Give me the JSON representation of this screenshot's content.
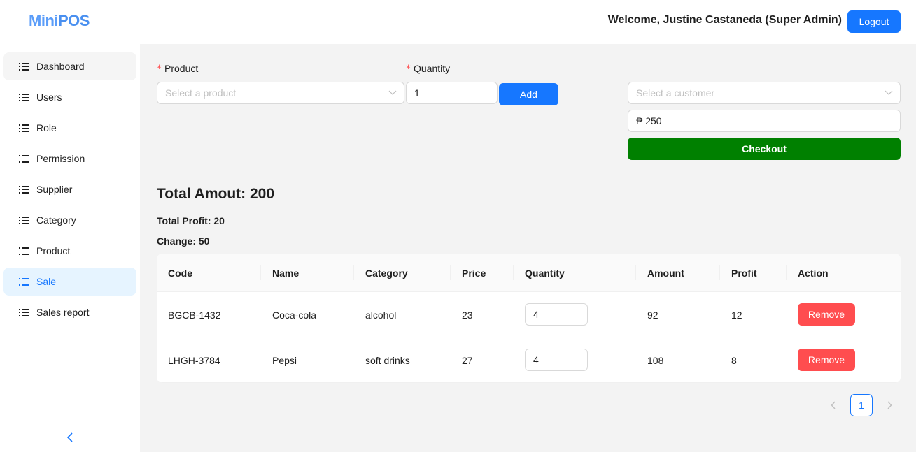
{
  "header": {
    "logo_mini": "Mini",
    "logo_pos": "POS",
    "welcome": "Welcome, Justine Castaneda (Super Admin)",
    "logout_label": "Logout"
  },
  "sidebar": {
    "items": [
      {
        "label": "Dashboard"
      },
      {
        "label": "Users"
      },
      {
        "label": "Role"
      },
      {
        "label": "Permission"
      },
      {
        "label": "Supplier"
      },
      {
        "label": "Category"
      },
      {
        "label": "Product"
      },
      {
        "label": "Sale"
      },
      {
        "label": "Sales report"
      }
    ],
    "active": "Sale",
    "collapse_icon": "chevron-left-icon"
  },
  "form": {
    "product_label": "Product",
    "product_placeholder": "Select a product",
    "quantity_label": "Quantity",
    "quantity_value": "1",
    "add_label": "Add",
    "customer_placeholder": "Select a customer",
    "payment_value": "₱ 250",
    "checkout_label": "Checkout"
  },
  "summary": {
    "total_amount": "Total Amout: 200",
    "total_profit": "Total Profit: 20",
    "change": "Change: 50"
  },
  "table": {
    "columns": [
      "Code",
      "Name",
      "Category",
      "Price",
      "Quantity",
      "Amount",
      "Profit",
      "Action"
    ],
    "rows": [
      {
        "code": "BGCB-1432",
        "name": "Coca-cola",
        "category": "alcohol",
        "price": "23",
        "quantity": "4",
        "amount": "92",
        "profit": "12",
        "action": "Remove"
      },
      {
        "code": "LHGH-3784",
        "name": "Pepsi",
        "category": "soft drinks",
        "price": "27",
        "quantity": "4",
        "amount": "108",
        "profit": "8",
        "action": "Remove"
      }
    ]
  },
  "pagination": {
    "current_page": "1",
    "prev_icon": "chevron-left-icon",
    "next_icon": "chevron-right-icon"
  },
  "colors": {
    "primary": "#1677ff",
    "checkout": "#008000",
    "remove": "#ff4d4f",
    "required": "#ff4d4f"
  }
}
